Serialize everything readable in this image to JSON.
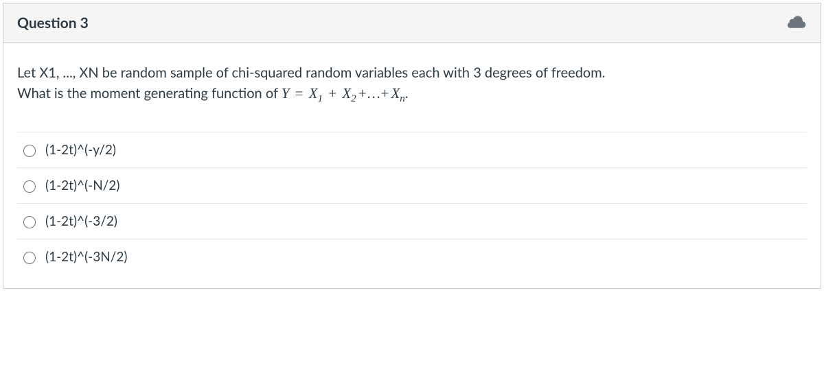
{
  "header": {
    "title": "Question 3"
  },
  "question": {
    "line1": "Let X1, ..., XN be random sample of chi-squared random variables each with 3 degrees of freedom.",
    "line2_prefix": "What is the moment generating function of ",
    "equation": {
      "Y": "Y",
      "equals": " = ",
      "X1": "X",
      "sub1": "1",
      "plus1": " + ",
      "X2": "X",
      "sub2": "2",
      "dots": "+…+",
      "Xn": "X",
      "subn": "n",
      "period": "."
    }
  },
  "options": [
    {
      "label": "(1-2t)^(-y/2)"
    },
    {
      "label": "(1-2t)^(-N/2)"
    },
    {
      "label": "(1-2t)^(-3/2)"
    },
    {
      "label": "(1-2t)^(-3N/2)"
    }
  ]
}
